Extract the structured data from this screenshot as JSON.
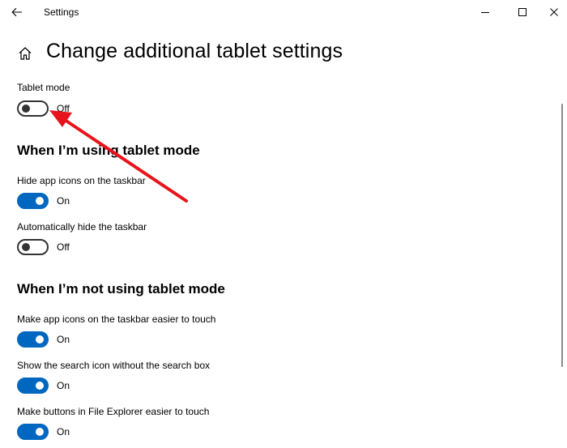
{
  "window": {
    "title": "Settings"
  },
  "header": {
    "title": "Change additional tablet settings"
  },
  "tablet_mode": {
    "label": "Tablet mode",
    "state": "Off",
    "on": false
  },
  "sections": [
    {
      "heading": "When I’m using tablet mode",
      "settings": [
        {
          "label": "Hide app icons on the taskbar",
          "state": "On",
          "on": true
        },
        {
          "label": "Automatically hide the taskbar",
          "state": "Off",
          "on": false
        }
      ]
    },
    {
      "heading": "When I’m not using tablet mode",
      "settings": [
        {
          "label": "Make app icons on the taskbar easier to touch",
          "state": "On",
          "on": true
        },
        {
          "label": "Show the search icon without the search box",
          "state": "On",
          "on": true
        },
        {
          "label": "Make buttons in File Explorer easier to touch",
          "state": "On",
          "on": true
        }
      ]
    }
  ],
  "icons": {
    "back": "back-arrow-icon",
    "home": "home-icon",
    "minimize": "minimize-icon",
    "maximize": "maximize-icon",
    "close": "close-icon"
  },
  "colors": {
    "toggle_on": "#0067c0",
    "toggle_off_border": "#333333",
    "annotation_arrow": "#e8141c"
  }
}
